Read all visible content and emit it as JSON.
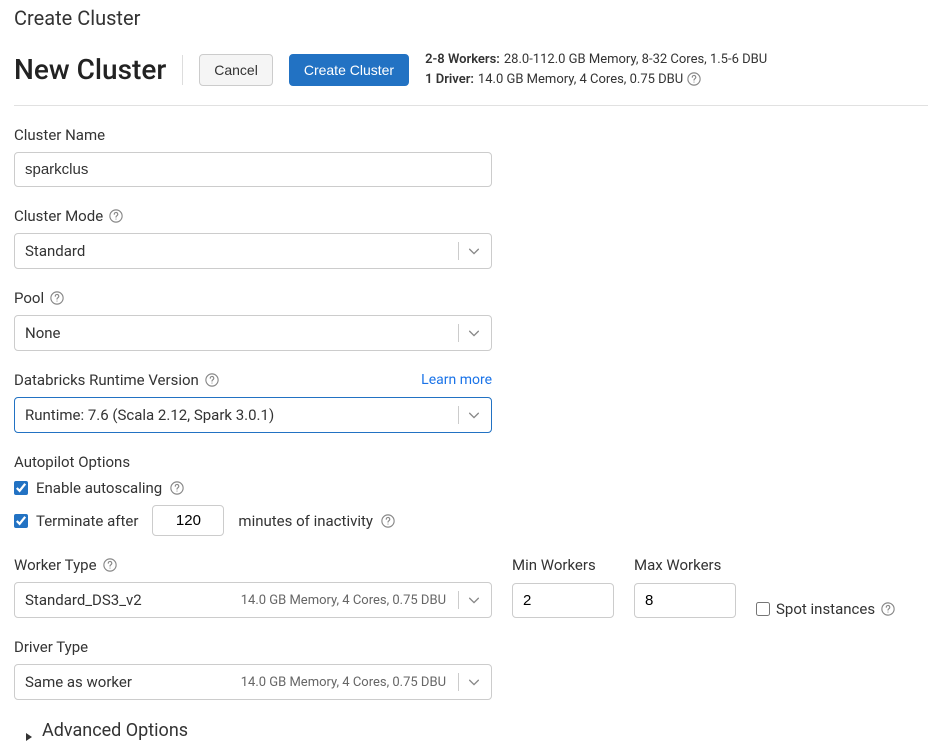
{
  "page": {
    "breadcrumb": "Create Cluster"
  },
  "header": {
    "title": "New Cluster",
    "cancel_label": "Cancel",
    "create_label": "Create Cluster"
  },
  "summary": {
    "workers_label": "2-8 Workers:",
    "workers_detail": "28.0-112.0 GB Memory, 8-32 Cores, 1.5-6 DBU",
    "driver_label": "1 Driver:",
    "driver_detail": "14.0 GB Memory, 4 Cores, 0.75 DBU"
  },
  "form": {
    "cluster_name": {
      "label": "Cluster Name",
      "value": "sparkclus"
    },
    "cluster_mode": {
      "label": "Cluster Mode",
      "value": "Standard"
    },
    "pool": {
      "label": "Pool",
      "value": "None"
    },
    "runtime": {
      "label": "Databricks Runtime Version",
      "learn_more": "Learn more",
      "value": "Runtime: 7.6 (Scala 2.12, Spark 3.0.1)"
    },
    "autopilot": {
      "title": "Autopilot Options",
      "autoscale_label": "Enable autoscaling",
      "autoscale_checked": true,
      "terminate_prefix": "Terminate after",
      "terminate_value": "120",
      "terminate_suffix": "minutes of inactivity",
      "terminate_checked": true
    },
    "worker_type": {
      "label": "Worker Type",
      "value": "Standard_DS3_v2",
      "meta": "14.0 GB Memory, 4 Cores, 0.75 DBU"
    },
    "min_workers": {
      "label": "Min Workers",
      "value": "2"
    },
    "max_workers": {
      "label": "Max Workers",
      "value": "8"
    },
    "spot": {
      "label": "Spot instances",
      "checked": false
    },
    "driver_type": {
      "label": "Driver Type",
      "value": "Same as worker",
      "meta": "14.0 GB Memory, 4 Cores, 0.75 DBU"
    },
    "advanced": {
      "label": "Advanced Options"
    }
  }
}
